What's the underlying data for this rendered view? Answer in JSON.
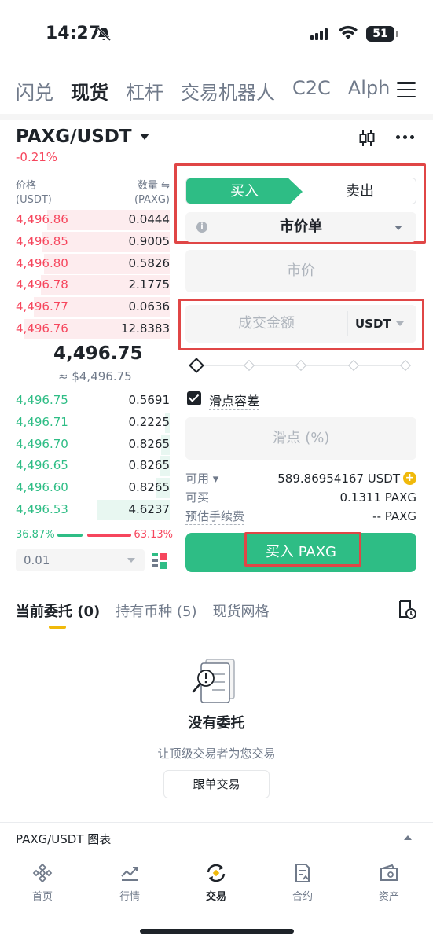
{
  "status_bar": {
    "time": "14:27",
    "battery": "51"
  },
  "nav_tabs": [
    "闪兑",
    "现货",
    "杠杆",
    "交易机器人",
    "C2C",
    "Alph"
  ],
  "nav_active": "现货",
  "pair": {
    "name": "PAXG/USDT",
    "change": "-0.21%"
  },
  "orderbook": {
    "price_header": "价格",
    "price_unit": "(USDT)",
    "qty_header": "数量 ⇋",
    "qty_unit": "(PAXG)",
    "asks": [
      {
        "price": "4,496.86",
        "qty": "0.0444",
        "depth": 0.72
      },
      {
        "price": "4,496.85",
        "qty": "0.9005",
        "depth": 0.75
      },
      {
        "price": "4,496.80",
        "qty": "0.5826",
        "depth": 0.74
      },
      {
        "price": "4,496.78",
        "qty": "2.1775",
        "depth": 0.76
      },
      {
        "price": "4,496.77",
        "qty": "0.0636",
        "depth": 0.8
      },
      {
        "price": "4,496.76",
        "qty": "12.8383",
        "depth": 0.86
      }
    ],
    "mid_price": "4,496.75",
    "mid_usd": "≈ $4,496.75",
    "bids": [
      {
        "price": "4,496.75",
        "qty": "0.5691",
        "depth": 0.0
      },
      {
        "price": "4,496.71",
        "qty": "0.2225",
        "depth": 0.03
      },
      {
        "price": "4,496.70",
        "qty": "0.8265",
        "depth": 0.05
      },
      {
        "price": "4,496.65",
        "qty": "0.8265",
        "depth": 0.06
      },
      {
        "price": "4,496.60",
        "qty": "0.8265",
        "depth": 0.08
      },
      {
        "price": "4,496.53",
        "qty": "4.6237",
        "depth": 0.43
      }
    ],
    "buy_ratio": "36.87%",
    "sell_ratio": "63.13%",
    "buy_ratio_value": 36.87,
    "tick_size": "0.01"
  },
  "order_form": {
    "buy_tab": "买入",
    "sell_tab": "卖出",
    "order_type": "市价单",
    "market_placeholder": "市价",
    "amount_placeholder": "成交金额",
    "amount_unit": "USDT",
    "slippage_label": "滑点容差",
    "slippage_placeholder": "滑点 (%)",
    "available_label": "可用",
    "available_value": "589.86954167 USDT",
    "can_buy_label": "可买",
    "can_buy_value": "0.1311 PAXG",
    "fee_label": "预估手续费",
    "fee_value": "-- PAXG",
    "submit": "买入 PAXG"
  },
  "lower_tabs": [
    "当前委托 (0)",
    "持有币种 (5)",
    "现货网格"
  ],
  "empty_state": {
    "title": "没有委托",
    "subtitle": "让顶级交易者为您交易",
    "button": "跟单交易"
  },
  "chart_bar": {
    "label": "PAXG/USDT 图表"
  },
  "bottom_nav": [
    "首页",
    "行情",
    "交易",
    "合约",
    "资产"
  ],
  "bottom_nav_active": "交易",
  "colors": {
    "green": "#2ebd85",
    "red": "#f6465d",
    "yellow": "#f0b90b",
    "highlight": "#e04646"
  }
}
